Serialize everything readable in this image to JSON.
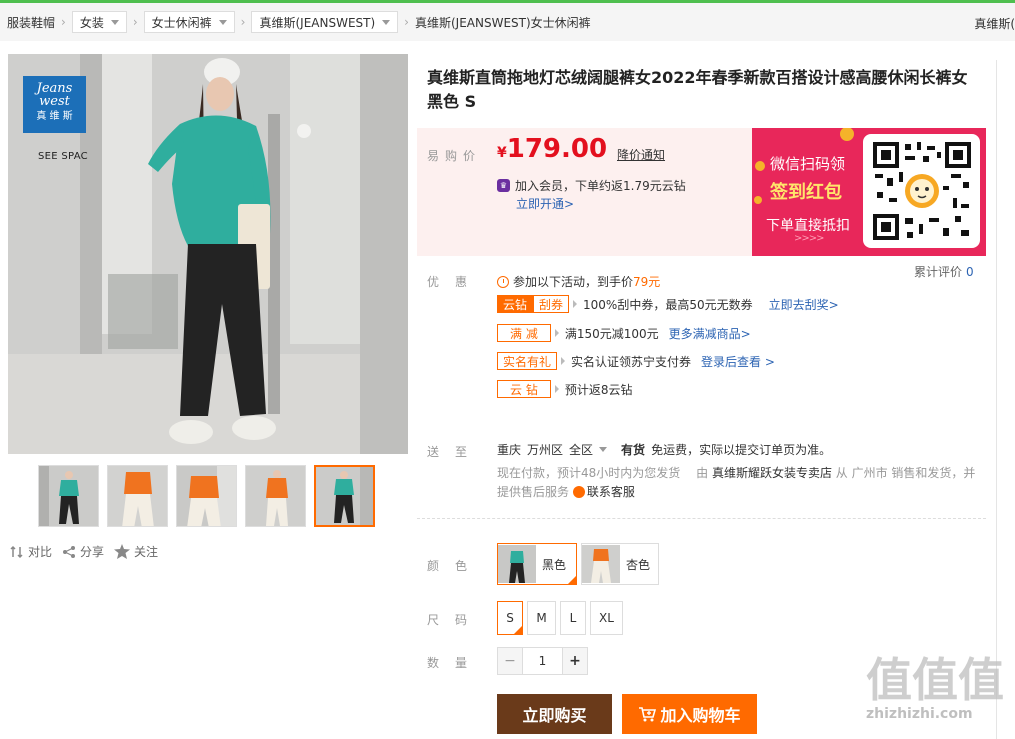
{
  "breadcrumb": {
    "home": "服装鞋帽",
    "items": [
      "女装",
      "女士休闲裤",
      "真维斯(JEANSWEST)"
    ],
    "current": "真维斯(JEANSWEST)女士休闲裤",
    "right_text": "真维斯("
  },
  "gallery": {
    "logo_line1": "Jeans",
    "logo_line2": "west",
    "logo_line3": "真 维 斯",
    "see_space": "SEE SPAC",
    "thumb_count": 5,
    "active_thumb": 4
  },
  "actions": {
    "compare": "对比",
    "share": "分享",
    "follow": "关注"
  },
  "product": {
    "title": "真维斯直筒拖地灯芯绒阔腿裤女2022年春季新款百搭设计感高腰休闲长裤女黑色 S"
  },
  "price": {
    "label": "易购价",
    "currency": "¥",
    "value": "179.00",
    "notify": "降价通知",
    "member_text": "加入会员，下单约返1.79元云钻",
    "member_link": "立即开通>"
  },
  "promo_banner": {
    "line1": "微信扫码领",
    "line2": "签到红包",
    "line3": "下单直接抵扣",
    "arrows": ">>>>"
  },
  "discounts": {
    "label": "优惠",
    "reviews_label": "累计评价",
    "reviews_count": "0",
    "activity_text": "参加以下活动，到手价",
    "activity_price": "79元",
    "rows": [
      {
        "tag1": "云钻",
        "tag2": "刮券",
        "text": "100%刮中券，最高50元无数券",
        "link": "立即去刮奖>"
      },
      {
        "tag": "满 减",
        "text": "满150元减100元",
        "link": "更多满减商品>"
      },
      {
        "tag": "实名有礼",
        "text": "实名认证领苏宁支付券",
        "link": "登录后查看 >"
      },
      {
        "tag": "云 钻",
        "text": "预计返8云钻",
        "link": ""
      }
    ]
  },
  "shipping": {
    "label": "送至",
    "city": "重庆",
    "district": "万州区",
    "area": "全区",
    "stock": "有货",
    "free_text": "免运费，实际以提交订单页为准。",
    "note_prefix": "现在付款，预计48小时内为您发货",
    "by": "由",
    "store": "真维斯耀跃女装专卖店",
    "note_mid": "从 广州市 销售和发货，并提供售后服务",
    "service": "联系客服"
  },
  "options": {
    "color_label": "颜色",
    "colors": [
      "黑色",
      "杏色"
    ],
    "size_label": "尺码",
    "sizes": [
      "S",
      "M",
      "L",
      "XL"
    ],
    "qty_label": "数量",
    "qty_value": "1",
    "minus": "−",
    "plus": "+"
  },
  "buttons": {
    "buy": "立即购买",
    "cart": "加入购物车"
  },
  "watermark": {
    "big": "值值值",
    "small": "zhizhizhi.com"
  },
  "colors": {
    "price_red": "#e3101e",
    "accent_orange": "#ff6a00",
    "link_blue": "#2d64b3",
    "buy_brown": "#6a3a1a",
    "promo_pink": "#e8275a"
  }
}
